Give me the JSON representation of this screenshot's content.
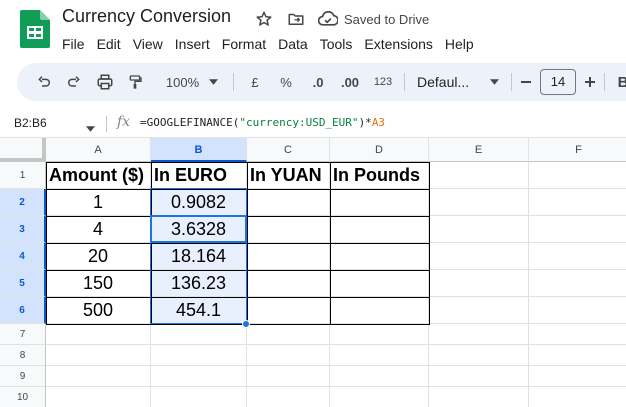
{
  "document": {
    "title": "Currency Conversion",
    "save_status": "Saved to Drive"
  },
  "menu": [
    "File",
    "Edit",
    "View",
    "Insert",
    "Format",
    "Data",
    "Tools",
    "Extensions",
    "Help"
  ],
  "toolbar": {
    "zoom": "100%",
    "currency_label": "£",
    "percent_label": "%",
    "decrease_decimal_label": ".0",
    "increase_decimal_label": ".00",
    "number_format_label": "123",
    "font": "Defaul...",
    "font_size": "14",
    "bold_partial": "B"
  },
  "formula_bar": {
    "name_box": "B2:B6",
    "fx": "fx",
    "formula_prefix": "=GOOGLEFINANCE(",
    "formula_string": "\"currency:USD_EUR\"",
    "formula_op": ")*",
    "formula_ref": "A3"
  },
  "grid": {
    "columns": [
      "A",
      "B",
      "C",
      "D",
      "E",
      "F"
    ],
    "rows": [
      "1",
      "2",
      "3",
      "4",
      "5",
      "6",
      "7",
      "8",
      "9",
      "10"
    ],
    "headers": [
      "Amount ($)",
      "In EURO",
      "In YUAN",
      "In Pounds"
    ],
    "amounts": [
      "1",
      "4",
      "20",
      "150",
      "500"
    ],
    "euro": [
      "0.9082",
      "3.6328",
      "18.164",
      "136.23",
      "454.1"
    ]
  },
  "colors": {
    "selection": "#1a73e8",
    "selection_fill": "#e8f0fe",
    "toolbar_bg": "#edf2fa",
    "sheets_green": "#0f9d58"
  },
  "icons": [
    "sheets-logo-icon",
    "star-icon",
    "move-folder-icon",
    "cloud-done-icon",
    "undo-icon",
    "redo-icon",
    "print-icon",
    "paint-format-icon",
    "dropdown-arrow-icon",
    "minus-icon",
    "plus-icon",
    "fx-icon"
  ]
}
